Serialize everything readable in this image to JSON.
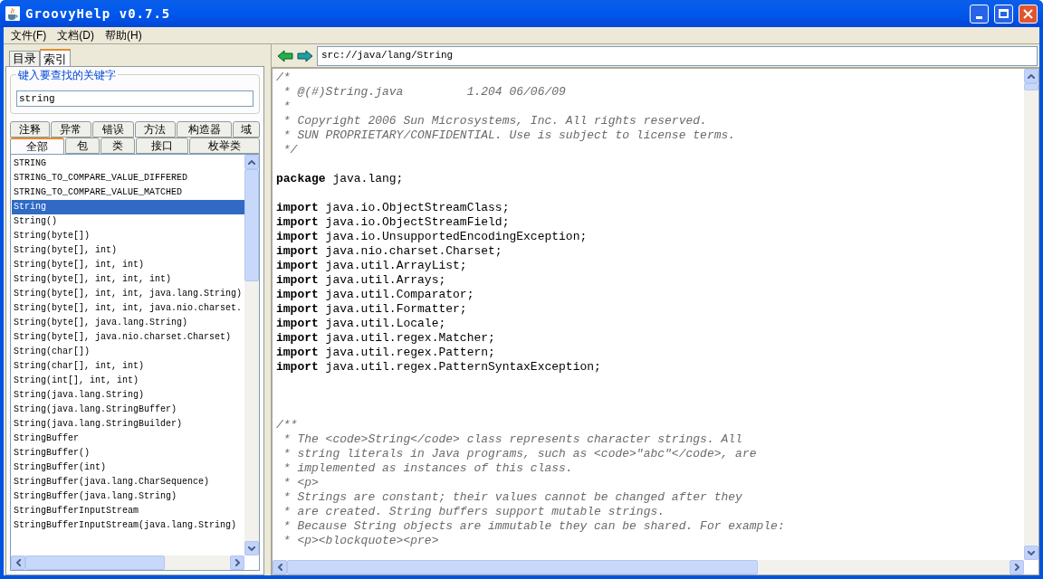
{
  "window": {
    "title": "GroovyHelp v0.7.5"
  },
  "menu": [
    "文件(F)",
    "文档(D)",
    "帮助(H)"
  ],
  "nav_tabs": [
    {
      "label": "目录",
      "selected": false
    },
    {
      "label": "索引",
      "selected": true
    }
  ],
  "search": {
    "legend": "键入要查找的关键字",
    "value": "string"
  },
  "filter_tabs": [
    [
      {
        "label": "注释",
        "selected": false
      },
      {
        "label": "异常",
        "selected": false
      },
      {
        "label": "错误",
        "selected": false
      },
      {
        "label": "方法",
        "selected": false
      },
      {
        "label": "构造器",
        "selected": false
      },
      {
        "label": "域",
        "selected": false
      }
    ],
    [
      {
        "label": "全部",
        "selected": true
      },
      {
        "label": "包",
        "selected": false
      },
      {
        "label": "类",
        "selected": false
      },
      {
        "label": "接口",
        "selected": false
      },
      {
        "label": "枚举类",
        "selected": false
      }
    ]
  ],
  "results": [
    {
      "text": "STRING",
      "selected": false
    },
    {
      "text": "STRING_TO_COMPARE_VALUE_DIFFERED",
      "selected": false
    },
    {
      "text": "STRING_TO_COMPARE_VALUE_MATCHED",
      "selected": false
    },
    {
      "text": "String",
      "selected": true
    },
    {
      "text": "String()",
      "selected": false
    },
    {
      "text": "String(byte[])",
      "selected": false
    },
    {
      "text": "String(byte[], int)",
      "selected": false
    },
    {
      "text": "String(byte[], int, int)",
      "selected": false
    },
    {
      "text": "String(byte[], int, int, int)",
      "selected": false
    },
    {
      "text": "String(byte[], int, int, java.lang.String)",
      "selected": false
    },
    {
      "text": "String(byte[], int, int, java.nio.charset.",
      "selected": false
    },
    {
      "text": "String(byte[], java.lang.String)",
      "selected": false
    },
    {
      "text": "String(byte[], java.nio.charset.Charset)",
      "selected": false
    },
    {
      "text": "String(char[])",
      "selected": false
    },
    {
      "text": "String(char[], int, int)",
      "selected": false
    },
    {
      "text": "String(int[], int, int)",
      "selected": false
    },
    {
      "text": "String(java.lang.String)",
      "selected": false
    },
    {
      "text": "String(java.lang.StringBuffer)",
      "selected": false
    },
    {
      "text": "String(java.lang.StringBuilder)",
      "selected": false
    },
    {
      "text": "StringBuffer",
      "selected": false
    },
    {
      "text": "StringBuffer()",
      "selected": false
    },
    {
      "text": "StringBuffer(int)",
      "selected": false
    },
    {
      "text": "StringBuffer(java.lang.CharSequence)",
      "selected": false
    },
    {
      "text": "StringBuffer(java.lang.String)",
      "selected": false
    },
    {
      "text": "StringBufferInputStream",
      "selected": false
    },
    {
      "text": "StringBufferInputStream(java.lang.String)",
      "selected": false
    }
  ],
  "address": "src://java/lang/String",
  "code": [
    {
      "kind": "comment",
      "text": "/*"
    },
    {
      "kind": "comment",
      "text": " * @(#)String.java         1.204 06/06/09"
    },
    {
      "kind": "comment",
      "text": " *"
    },
    {
      "kind": "comment",
      "text": " * Copyright 2006 Sun Microsystems, Inc. All rights reserved."
    },
    {
      "kind": "comment",
      "text": " * SUN PROPRIETARY/CONFIDENTIAL. Use is subject to license terms."
    },
    {
      "kind": "comment",
      "text": " */"
    },
    {
      "kind": "blank"
    },
    {
      "kind": "code",
      "text": "**package** java.lang;"
    },
    {
      "kind": "blank"
    },
    {
      "kind": "code",
      "text": "**import** java.io.ObjectStreamClass;"
    },
    {
      "kind": "code",
      "text": "**import** java.io.ObjectStreamField;"
    },
    {
      "kind": "code",
      "text": "**import** java.io.UnsupportedEncodingException;"
    },
    {
      "kind": "code",
      "text": "**import** java.nio.charset.Charset;"
    },
    {
      "kind": "code",
      "text": "**import** java.util.ArrayList;"
    },
    {
      "kind": "code",
      "text": "**import** java.util.Arrays;"
    },
    {
      "kind": "code",
      "text": "**import** java.util.Comparator;"
    },
    {
      "kind": "code",
      "text": "**import** java.util.Formatter;"
    },
    {
      "kind": "code",
      "text": "**import** java.util.Locale;"
    },
    {
      "kind": "code",
      "text": "**import** java.util.regex.Matcher;"
    },
    {
      "kind": "code",
      "text": "**import** java.util.regex.Pattern;"
    },
    {
      "kind": "code",
      "text": "**import** java.util.regex.PatternSyntaxException;"
    },
    {
      "kind": "blank"
    },
    {
      "kind": "blank"
    },
    {
      "kind": "blank"
    },
    {
      "kind": "comment",
      "text": "/**"
    },
    {
      "kind": "comment",
      "text": " * The <code>String</code> class represents character strings. All"
    },
    {
      "kind": "comment",
      "text": " * string literals in Java programs, such as <code>\"abc\"</code>, are"
    },
    {
      "kind": "comment",
      "text": " * implemented as instances of this class."
    },
    {
      "kind": "comment",
      "text": " * <p>"
    },
    {
      "kind": "comment",
      "text": " * Strings are constant; their values cannot be changed after they"
    },
    {
      "kind": "comment",
      "text": " * are created. String buffers support mutable strings."
    },
    {
      "kind": "comment",
      "text": " * Because String objects are immutable they can be shared. For example:"
    },
    {
      "kind": "comment",
      "text": " * <p><blockquote><pre>"
    }
  ]
}
